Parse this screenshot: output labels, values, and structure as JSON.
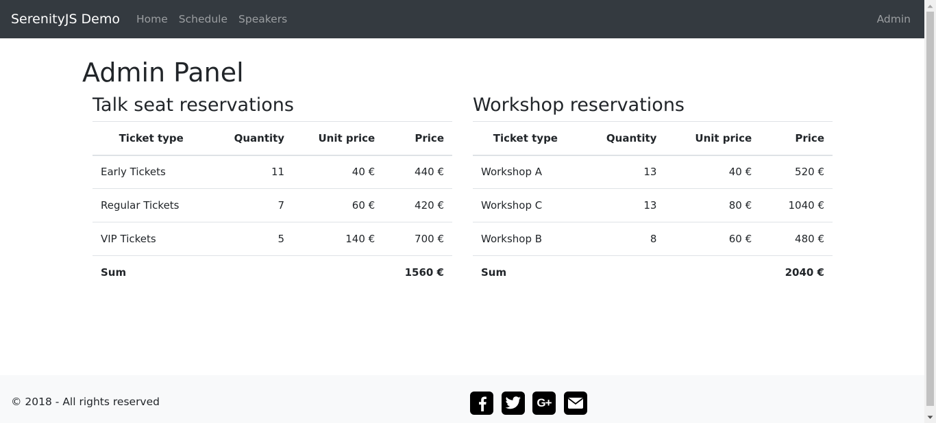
{
  "navbar": {
    "brand": "SerenityJS Demo",
    "links": [
      "Home",
      "Schedule",
      "Speakers"
    ],
    "right_link": "Admin"
  },
  "main": {
    "title": "Admin Panel",
    "talk": {
      "heading": "Talk seat reservations",
      "columns": [
        "Ticket type",
        "Quantity",
        "Unit price",
        "Price"
      ],
      "rows": [
        [
          "Early Tickets",
          "11",
          "40 €",
          "440 €"
        ],
        [
          "Regular Tickets",
          "7",
          "60 €",
          "420 €"
        ],
        [
          "VIP Tickets",
          "5",
          "140 €",
          "700 €"
        ]
      ],
      "sum_label": "Sum",
      "sum_value": "1560 €"
    },
    "workshop": {
      "heading": "Workshop reservations",
      "columns": [
        "Ticket type",
        "Quantity",
        "Unit price",
        "Price"
      ],
      "rows": [
        [
          "Workshop A",
          "13",
          "40 €",
          "520 €"
        ],
        [
          "Workshop C",
          "13",
          "80 €",
          "1040 €"
        ],
        [
          "Workshop B",
          "8",
          "60 €",
          "480 €"
        ]
      ],
      "sum_label": "Sum",
      "sum_value": "2040 €"
    }
  },
  "footer": {
    "copyright": "© 2018 - All rights reserved",
    "social_icons": [
      "facebook-icon",
      "twitter-icon",
      "google-plus-icon",
      "envelope-icon"
    ],
    "google_plus_text": "G+"
  }
}
